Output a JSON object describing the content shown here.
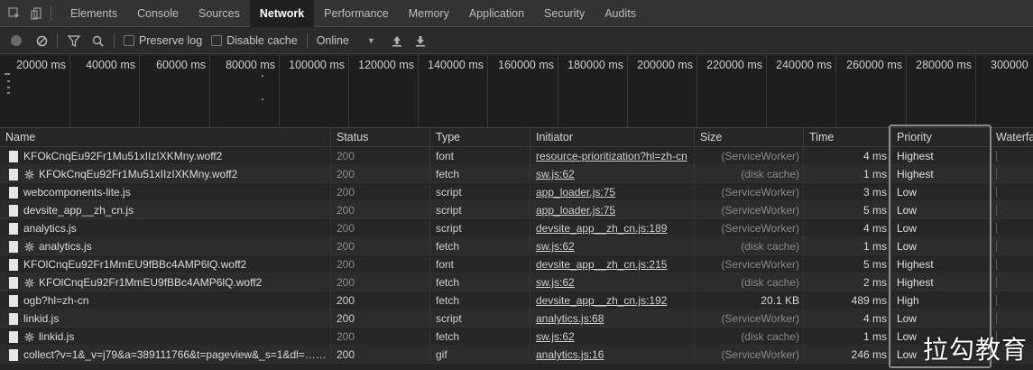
{
  "tabs": [
    "Elements",
    "Console",
    "Sources",
    "Network",
    "Performance",
    "Memory",
    "Application",
    "Security",
    "Audits"
  ],
  "active_tab": "Network",
  "toolbar": {
    "preserve_log": "Preserve log",
    "disable_cache": "Disable cache",
    "throttle": "Online"
  },
  "overview_ticks": [
    "20000 ms",
    "40000 ms",
    "60000 ms",
    "80000 ms",
    "100000 ms",
    "120000 ms",
    "140000 ms",
    "160000 ms",
    "180000 ms",
    "200000 ms",
    "220000 ms",
    "240000 ms",
    "260000 ms",
    "280000 ms",
    "300000"
  ],
  "columns": [
    "Name",
    "Status",
    "Type",
    "Initiator",
    "Size",
    "Time",
    "Priority",
    "Waterfa"
  ],
  "rows": [
    {
      "name": "KFOkCnqEu92Fr1Mu51xIIzIXKMny.woff2",
      "sw": false,
      "status": "200",
      "type": "font",
      "initiator": "resource-prioritization?hl=zh-cn",
      "size": "(ServiceWorker)",
      "time": "4 ms",
      "priority": "Highest"
    },
    {
      "name": "KFOkCnqEu92Fr1Mu51xIIzIXKMny.woff2",
      "sw": true,
      "status": "200",
      "type": "fetch",
      "initiator": "sw.js:62",
      "size": "(disk cache)",
      "time": "1 ms",
      "priority": "Highest"
    },
    {
      "name": "webcomponents-lite.js",
      "sw": false,
      "status": "200",
      "type": "script",
      "initiator": "app_loader.js:75",
      "size": "(ServiceWorker)",
      "time": "3 ms",
      "priority": "Low"
    },
    {
      "name": "devsite_app__zh_cn.js",
      "sw": false,
      "status": "200",
      "type": "script",
      "initiator": "app_loader.js:75",
      "size": "(ServiceWorker)",
      "time": "5 ms",
      "priority": "Low"
    },
    {
      "name": "analytics.js",
      "sw": false,
      "status": "200",
      "type": "script",
      "initiator": "devsite_app__zh_cn.js:189",
      "size": "(ServiceWorker)",
      "time": "4 ms",
      "priority": "Low"
    },
    {
      "name": "analytics.js",
      "sw": true,
      "status": "200",
      "type": "fetch",
      "initiator": "sw.js:62",
      "size": "(disk cache)",
      "time": "1 ms",
      "priority": "Low"
    },
    {
      "name": "KFOlCnqEu92Fr1MmEU9fBBc4AMP6lQ.woff2",
      "sw": false,
      "status": "200",
      "type": "font",
      "initiator": "devsite_app__zh_cn.js:215",
      "size": "(ServiceWorker)",
      "time": "5 ms",
      "priority": "Highest"
    },
    {
      "name": "KFOlCnqEu92Fr1MmEU9fBBc4AMP6lQ.woff2",
      "sw": true,
      "status": "200",
      "type": "fetch",
      "initiator": "sw.js:62",
      "size": "(disk cache)",
      "time": "2 ms",
      "priority": "Highest"
    },
    {
      "name": "ogb?hl=zh-cn",
      "sw": false,
      "status": "200",
      "type": "fetch",
      "initiator": "devsite_app__zh_cn.js:192",
      "size": "20.1 KB",
      "time": "489 ms",
      "priority": "High"
    },
    {
      "name": "linkid.js",
      "sw": false,
      "status": "200",
      "type": "script",
      "initiator": "analytics.js:68",
      "size": "(ServiceWorker)",
      "time": "4 ms",
      "priority": "Low"
    },
    {
      "name": "linkid.js",
      "sw": true,
      "status": "200",
      "type": "fetch",
      "initiator": "sw.js:62",
      "size": "(disk cache)",
      "time": "1 ms",
      "priority": "Low"
    },
    {
      "name": "collect?v=1&_v=j79&a=389111766&t=pageview&_s=1&dl=…nta…",
      "sw": false,
      "status": "200",
      "type": "gif",
      "initiator": "analytics.js:16",
      "size": "(ServiceWorker)",
      "time": "246 ms",
      "priority": "Low"
    }
  ],
  "watermark": "拉勾教育",
  "colors": {
    "active_tab_bg": "#1f1f1f",
    "panel_bg": "#242424",
    "dim_text": "#8a8a8a",
    "highlight_box": "#8c8c8c"
  }
}
